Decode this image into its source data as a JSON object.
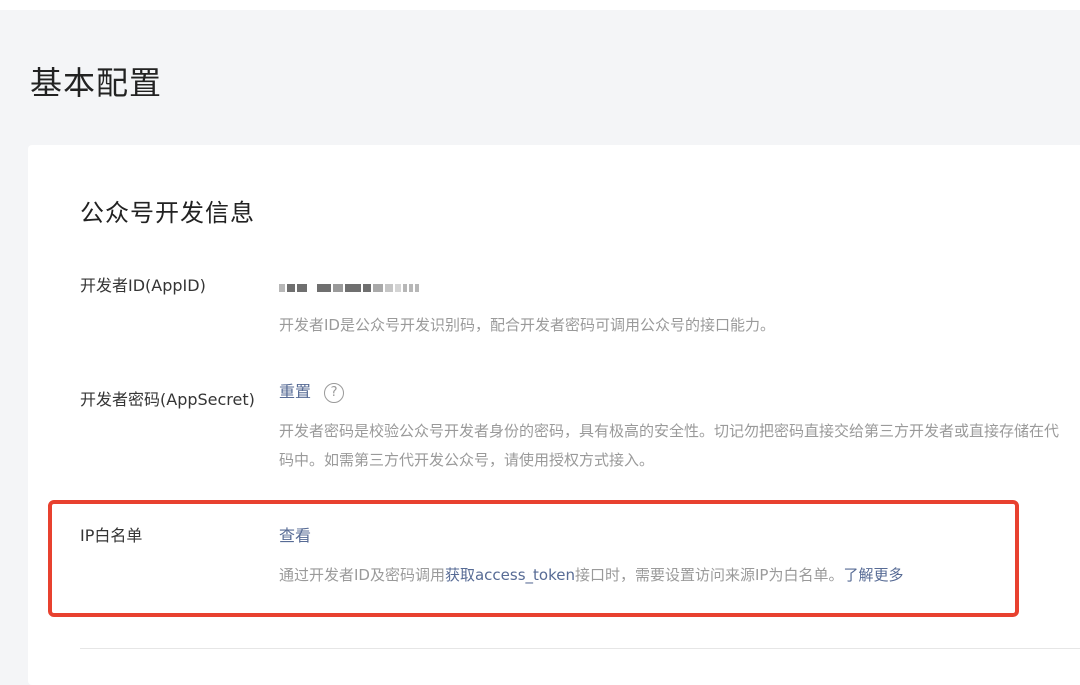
{
  "page": {
    "title": "基本配置"
  },
  "section": {
    "title": "公众号开发信息"
  },
  "rows": {
    "appid": {
      "label": "开发者ID(AppID)",
      "desc": "开发者ID是公众号开发识别码，配合开发者密码可调用公众号的接口能力。"
    },
    "appsecret": {
      "label": "开发者密码(AppSecret)",
      "action": "重置",
      "help_icon": "?",
      "desc": "开发者密码是校验公众号开发者身份的密码，具有极高的安全性。切记勿把密码直接交给第三方开发者或直接存储在代码中。如需第三方代开发公众号，请使用授权方式接入。"
    },
    "ip_whitelist": {
      "label": "IP白名单",
      "action": "查看",
      "desc_prefix": "通过开发者ID及密码调用",
      "desc_link": "获取access_token",
      "desc_middle": "接口时，需要设置访问来源IP为白名单。",
      "desc_more": "了解更多"
    }
  },
  "colors": {
    "link": "#576b95",
    "highlight": "#e8412f",
    "muted": "#9a9a9a"
  }
}
